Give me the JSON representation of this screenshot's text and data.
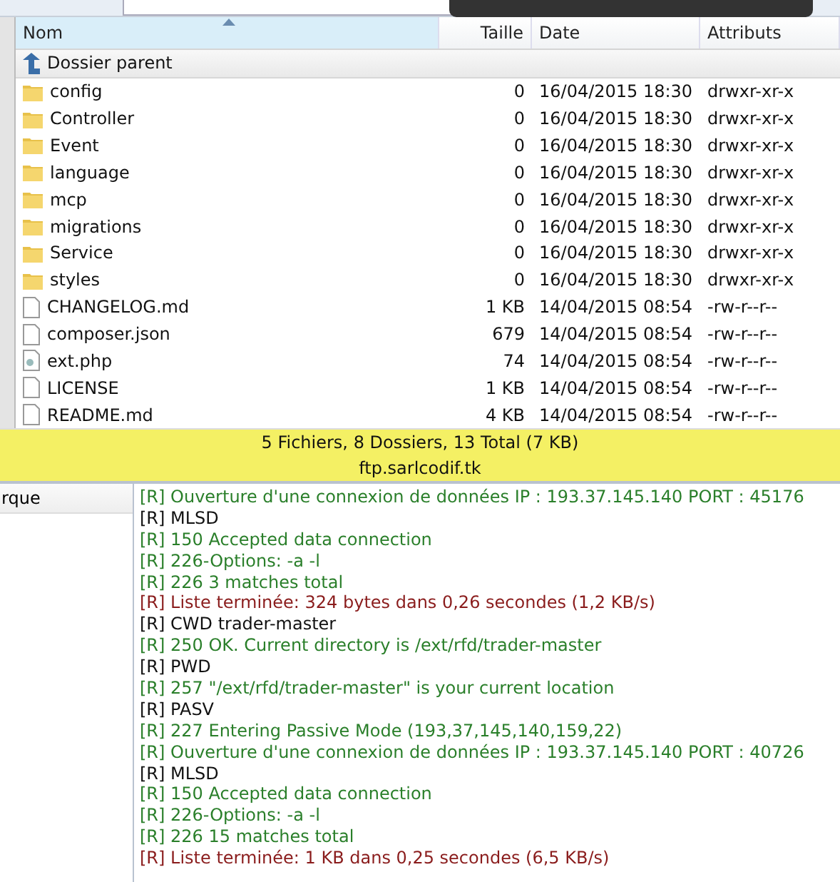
{
  "file_list": {
    "columns": [
      {
        "label": "Nom",
        "sorted": true
      },
      {
        "label": "Taille",
        "sorted": false
      },
      {
        "label": "Date",
        "sorted": false
      },
      {
        "label": "Attributs",
        "sorted": false
      }
    ],
    "parent_row": {
      "label": "Dossier parent"
    },
    "rows": [
      {
        "kind": "folder",
        "name": "config",
        "size": "0",
        "date": "16/04/2015 18:30",
        "attributes": "drwxr-xr-x"
      },
      {
        "kind": "folder",
        "name": "Controller",
        "size": "0",
        "date": "16/04/2015 18:30",
        "attributes": "drwxr-xr-x"
      },
      {
        "kind": "folder",
        "name": "Event",
        "size": "0",
        "date": "16/04/2015 18:30",
        "attributes": "drwxr-xr-x"
      },
      {
        "kind": "folder",
        "name": "language",
        "size": "0",
        "date": "16/04/2015 18:30",
        "attributes": "drwxr-xr-x"
      },
      {
        "kind": "folder",
        "name": "mcp",
        "size": "0",
        "date": "16/04/2015 18:30",
        "attributes": "drwxr-xr-x"
      },
      {
        "kind": "folder",
        "name": "migrations",
        "size": "0",
        "date": "16/04/2015 18:30",
        "attributes": "drwxr-xr-x"
      },
      {
        "kind": "folder",
        "name": "Service",
        "size": "0",
        "date": "16/04/2015 18:30",
        "attributes": "drwxr-xr-x"
      },
      {
        "kind": "folder",
        "name": "styles",
        "size": "0",
        "date": "16/04/2015 18:30",
        "attributes": "drwxr-xr-x"
      },
      {
        "kind": "file",
        "name": "CHANGELOG.md",
        "size": "1 KB",
        "date": "14/04/2015 08:54",
        "attributes": "-rw-r--r--"
      },
      {
        "kind": "file",
        "name": "composer.json",
        "size": "679",
        "date": "14/04/2015 08:54",
        "attributes": "-rw-r--r--"
      },
      {
        "kind": "script",
        "name": "ext.php",
        "size": "74",
        "date": "14/04/2015 08:54",
        "attributes": "-rw-r--r--"
      },
      {
        "kind": "file",
        "name": "LICENSE",
        "size": "1 KB",
        "date": "14/04/2015 08:54",
        "attributes": "-rw-r--r--"
      },
      {
        "kind": "file",
        "name": "README.md",
        "size": "4 KB",
        "date": "14/04/2015 08:54",
        "attributes": "-rw-r--r--"
      }
    ]
  },
  "status_bar": {
    "summary": "5 Fichiers, 8 Dossiers, 13 Total (7 KB)",
    "host": "ftp.sarlcodif.tk"
  },
  "side_panel": {
    "item": "rque"
  },
  "log": [
    {
      "kind": "response",
      "text": "[R] Ouverture d'une connexion de données IP : 193.37.145.140 PORT : 45176"
    },
    {
      "kind": "command",
      "text": "[R] MLSD"
    },
    {
      "kind": "response",
      "text": "[R] 150 Accepted data connection"
    },
    {
      "kind": "response",
      "text": "[R] 226-Options: -a -l"
    },
    {
      "kind": "response",
      "text": "[R] 226 3 matches total"
    },
    {
      "kind": "transfer",
      "text": "[R] Liste terminée: 324 bytes dans 0,26 secondes (1,2 KB/s)"
    },
    {
      "kind": "command",
      "text": "[R] CWD trader-master"
    },
    {
      "kind": "response",
      "text": "[R] 250 OK. Current directory is /ext/rfd/trader-master"
    },
    {
      "kind": "command",
      "text": "[R] PWD"
    },
    {
      "kind": "response",
      "text": "[R] 257 \"/ext/rfd/trader-master\" is your current location"
    },
    {
      "kind": "command",
      "text": "[R] PASV"
    },
    {
      "kind": "response",
      "text": "[R] 227 Entering Passive Mode (193,37,145,140,159,22)"
    },
    {
      "kind": "response",
      "text": "[R] Ouverture d'une connexion de données IP : 193.37.145.140 PORT : 40726"
    },
    {
      "kind": "command",
      "text": "[R] MLSD"
    },
    {
      "kind": "response",
      "text": "[R] 150 Accepted data connection"
    },
    {
      "kind": "response",
      "text": "[R] 226-Options: -a -l"
    },
    {
      "kind": "response",
      "text": "[R] 226 15 matches total"
    },
    {
      "kind": "transfer",
      "text": "[R] Liste terminée: 1 KB dans 0,25 secondes (6,5 KB/s)"
    }
  ]
}
